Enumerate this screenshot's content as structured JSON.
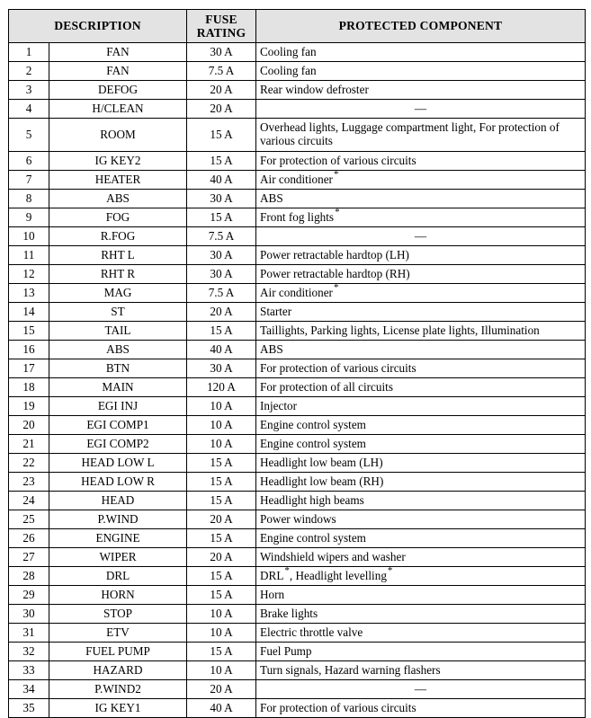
{
  "table": {
    "headers": {
      "description": "DESCRIPTION",
      "fuse_rating": "FUSE\nRATING",
      "fuse_rating_line1": "FUSE",
      "fuse_rating_line2": "RATING",
      "protected_component": "PROTECTED COMPONENT"
    },
    "header_background": "#e3e3e3",
    "border_color": "#000000",
    "text_color": "#000000",
    "dash_symbol": "—",
    "footnote_symbol": "*",
    "row_count": 35,
    "rows": [
      {
        "no": "1",
        "name": "FAN",
        "rating": "30 A",
        "component": "Cooling fan",
        "star": false
      },
      {
        "no": "2",
        "name": "FAN",
        "rating": "7.5 A",
        "component": "Cooling fan",
        "star": false
      },
      {
        "no": "3",
        "name": "DEFOG",
        "rating": "20 A",
        "component": "Rear window defroster",
        "star": false
      },
      {
        "no": "4",
        "name": "H/CLEAN",
        "rating": "20 A",
        "component": "—",
        "star": false,
        "dash": true
      },
      {
        "no": "5",
        "name": "ROOM",
        "rating": "15 A",
        "component": "Overhead lights, Luggage compartment light, For protection of various circuits",
        "star": false,
        "tall": true
      },
      {
        "no": "6",
        "name": "IG KEY2",
        "rating": "15 A",
        "component": "For protection of various circuits",
        "star": false
      },
      {
        "no": "7",
        "name": "HEATER",
        "rating": "40 A",
        "component": "Air conditioner",
        "star": true
      },
      {
        "no": "8",
        "name": "ABS",
        "rating": "30 A",
        "component": "ABS",
        "star": false
      },
      {
        "no": "9",
        "name": "FOG",
        "rating": "15 A",
        "component": "Front fog lights",
        "star": true
      },
      {
        "no": "10",
        "name": "R.FOG",
        "rating": "7.5 A",
        "component": "—",
        "star": false,
        "dash": true
      },
      {
        "no": "11",
        "name": "RHT L",
        "rating": "30 A",
        "component": "Power retractable hardtop (LH)",
        "star": false
      },
      {
        "no": "12",
        "name": "RHT R",
        "rating": "30 A",
        "component": "Power retractable hardtop (RH)",
        "star": false
      },
      {
        "no": "13",
        "name": "MAG",
        "rating": "7.5 A",
        "component": "Air conditioner",
        "star": true
      },
      {
        "no": "14",
        "name": "ST",
        "rating": "20 A",
        "component": "Starter",
        "star": false
      },
      {
        "no": "15",
        "name": "TAIL",
        "rating": "15 A",
        "component": "Taillights, Parking lights, License plate lights, Illumination",
        "star": false
      },
      {
        "no": "16",
        "name": "ABS",
        "rating": "40 A",
        "component": "ABS",
        "star": false
      },
      {
        "no": "17",
        "name": "BTN",
        "rating": "30 A",
        "component": "For protection of various circuits",
        "star": false
      },
      {
        "no": "18",
        "name": "MAIN",
        "rating": "120 A",
        "component": "For protection of all circuits",
        "star": false
      },
      {
        "no": "19",
        "name": "EGI INJ",
        "rating": "10 A",
        "component": "Injector",
        "star": false
      },
      {
        "no": "20",
        "name": "EGI COMP1",
        "rating": "10 A",
        "component": "Engine control system",
        "star": false
      },
      {
        "no": "21",
        "name": "EGI COMP2",
        "rating": "10 A",
        "component": "Engine control system",
        "star": false
      },
      {
        "no": "22",
        "name": "HEAD LOW L",
        "rating": "15 A",
        "component": "Headlight low beam (LH)",
        "star": false
      },
      {
        "no": "23",
        "name": "HEAD LOW R",
        "rating": "15 A",
        "component": "Headlight low beam (RH)",
        "star": false
      },
      {
        "no": "24",
        "name": "HEAD",
        "rating": "15 A",
        "component": "Headlight high beams",
        "star": false
      },
      {
        "no": "25",
        "name": "P.WIND",
        "rating": "20 A",
        "component": "Power windows",
        "star": false
      },
      {
        "no": "26",
        "name": "ENGINE",
        "rating": "15 A",
        "component": "Engine control system",
        "star": false
      },
      {
        "no": "27",
        "name": "WIPER",
        "rating": "20 A",
        "component": "Windshield wipers and washer",
        "star": false
      },
      {
        "no": "28",
        "name": "DRL",
        "rating": "15 A",
        "component": "DRL",
        "component_parts": [
          "DRL",
          ", Headlight levelling"
        ],
        "double_star": true
      },
      {
        "no": "29",
        "name": "HORN",
        "rating": "15 A",
        "component": "Horn",
        "star": false
      },
      {
        "no": "30",
        "name": "STOP",
        "rating": "10 A",
        "component": "Brake lights",
        "star": false
      },
      {
        "no": "31",
        "name": "ETV",
        "rating": "10 A",
        "component": "Electric throttle valve",
        "star": false
      },
      {
        "no": "32",
        "name": "FUEL PUMP",
        "rating": "15 A",
        "component": "Fuel Pump",
        "star": false
      },
      {
        "no": "33",
        "name": "HAZARD",
        "rating": "10 A",
        "component": "Turn signals, Hazard warning flashers",
        "star": false
      },
      {
        "no": "34",
        "name": "P.WIND2",
        "rating": "20 A",
        "component": "—",
        "star": false,
        "dash": true
      },
      {
        "no": "35",
        "name": "IG KEY1",
        "rating": "40 A",
        "component": "For protection of various circuits",
        "star": false
      }
    ]
  }
}
